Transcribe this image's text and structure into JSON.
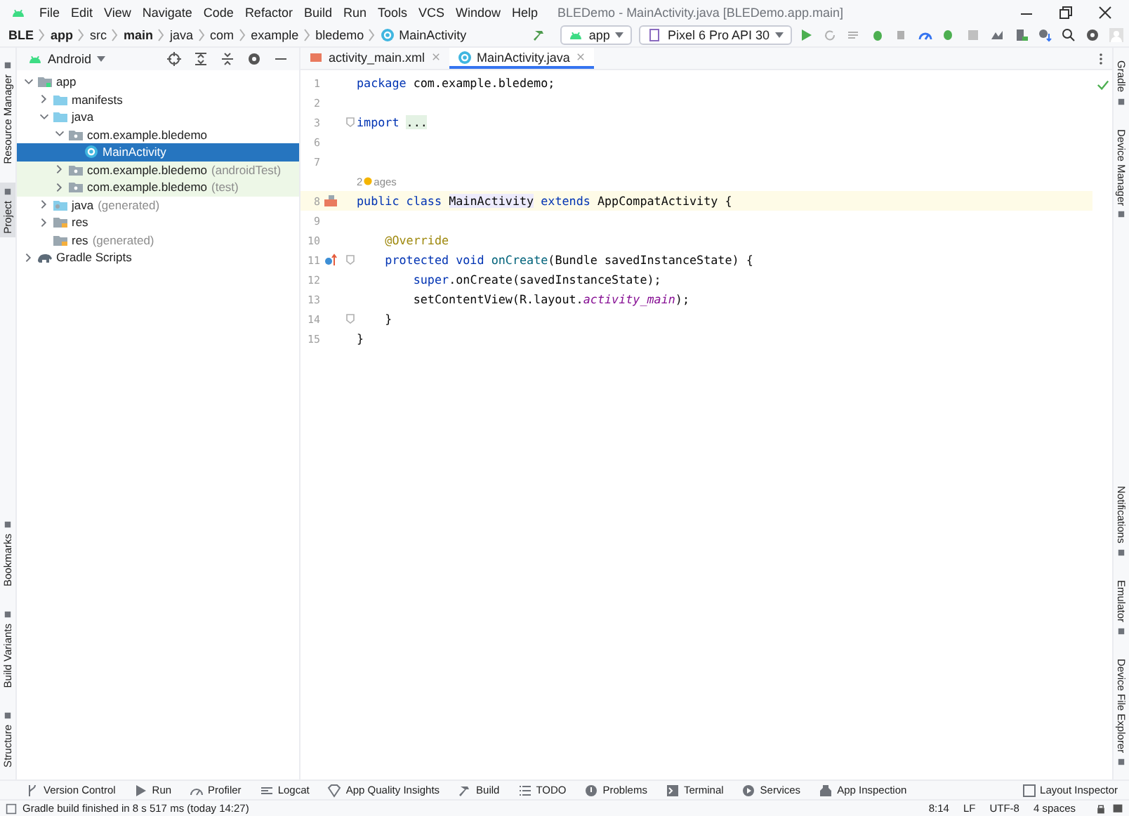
{
  "window": {
    "title": "BLEDemo - MainActivity.java [BLEDemo.app.main]"
  },
  "menu": [
    "File",
    "Edit",
    "View",
    "Navigate",
    "Code",
    "Refactor",
    "Build",
    "Run",
    "Tools",
    "VCS",
    "Window",
    "Help"
  ],
  "breadcrumbs": [
    {
      "label": "BLE",
      "bold": true,
      "kind": "text"
    },
    {
      "label": "app",
      "bold": true,
      "kind": "text"
    },
    {
      "label": "src",
      "bold": false,
      "kind": "text"
    },
    {
      "label": "main",
      "bold": true,
      "kind": "text"
    },
    {
      "label": "java",
      "bold": false,
      "kind": "text"
    },
    {
      "label": "com",
      "bold": false,
      "kind": "text"
    },
    {
      "label": "example",
      "bold": false,
      "kind": "text"
    },
    {
      "label": "bledemo",
      "bold": false,
      "kind": "text"
    },
    {
      "label": "MainActivity",
      "bold": false,
      "kind": "class"
    }
  ],
  "toolbar": {
    "configuration": "app",
    "device": "Pixel 6 Pro API 30"
  },
  "left_stripe": {
    "top": [
      {
        "label": "Resource Manager",
        "selected": false
      },
      {
        "label": "Project",
        "selected": true
      }
    ],
    "bottom": [
      {
        "label": "Bookmarks",
        "selected": false
      },
      {
        "label": "Build Variants",
        "selected": false
      },
      {
        "label": "Structure",
        "selected": false
      }
    ]
  },
  "right_stripe": {
    "top": [
      {
        "label": "Gradle"
      },
      {
        "label": "Device Manager"
      }
    ],
    "bottom": [
      {
        "label": "Notifications"
      },
      {
        "label": "Emulator"
      },
      {
        "label": "Device File Explorer"
      }
    ]
  },
  "project_panel": {
    "view": "Android",
    "tree": [
      {
        "label": "app",
        "kind": "module",
        "expanded": true,
        "selected": false,
        "test_source": false,
        "children": [
          {
            "label": "manifests",
            "kind": "folder",
            "expanded": false,
            "selected": false,
            "test_source": false
          },
          {
            "label": "java",
            "kind": "folder",
            "expanded": true,
            "selected": false,
            "test_source": false,
            "children": [
              {
                "label": "com.example.bledemo",
                "kind": "package",
                "expanded": true,
                "selected": false,
                "test_source": false,
                "children": [
                  {
                    "label": "MainActivity",
                    "kind": "class",
                    "selected": true,
                    "test_source": false
                  }
                ]
              },
              {
                "label": "com.example.bledemo",
                "suffix": "(androidTest)",
                "kind": "package",
                "expanded": false,
                "selected": false,
                "test_source": true
              },
              {
                "label": "com.example.bledemo",
                "suffix": "(test)",
                "kind": "package",
                "expanded": false,
                "selected": false,
                "test_source": true
              }
            ]
          },
          {
            "label": "java",
            "suffix": "(generated)",
            "kind": "generated",
            "expanded": false,
            "selected": false,
            "test_source": false
          },
          {
            "label": "res",
            "kind": "res",
            "expanded": false,
            "selected": false,
            "test_source": false
          },
          {
            "label": "res",
            "suffix": "(generated)",
            "kind": "res",
            "selected": false,
            "test_source": false
          }
        ]
      },
      {
        "label": "Gradle Scripts",
        "kind": "gradle",
        "expanded": false,
        "selected": false,
        "test_source": false
      }
    ]
  },
  "editor": {
    "tabs": [
      {
        "label": "activity_main.xml",
        "kind": "xml",
        "selected": false
      },
      {
        "label": "MainActivity.java",
        "kind": "class",
        "selected": true
      }
    ],
    "lines": [
      {
        "kind": "code",
        "number": "1",
        "current": false,
        "fold": false,
        "tokens": [
          {
            "text": "package",
            "kind": "keyword"
          },
          {
            "text": " com.example.bledemo;",
            "kind": "plain"
          }
        ]
      },
      {
        "kind": "code",
        "number": "2",
        "current": false,
        "fold": false
      },
      {
        "kind": "code",
        "number": "3",
        "current": false,
        "fold": true,
        "tokens": [
          {
            "text": "import ",
            "kind": "keyword"
          },
          {
            "text": "...",
            "kind": "folded"
          }
        ]
      },
      {
        "kind": "code",
        "number": "6",
        "current": false,
        "fold": false
      },
      {
        "kind": "code",
        "number": "7",
        "current": false,
        "fold": false
      },
      {
        "kind": "hint",
        "before": "2",
        "after": "ages"
      },
      {
        "kind": "implemented_code",
        "number": "8",
        "current": true,
        "fold": false,
        "tokens": [
          {
            "text": "public class ",
            "kind": "keyword"
          },
          {
            "text": "MainActivity",
            "kind": "highlighted"
          },
          {
            "text": " extends",
            "kind": "keyword"
          },
          {
            "text": " AppCompatActivity {",
            "kind": "plain"
          }
        ]
      },
      {
        "kind": "code",
        "number": "9",
        "current": false,
        "fold": false
      },
      {
        "kind": "code",
        "number": "10",
        "current": false,
        "fold": false,
        "tokens": [
          {
            "text": "    @Override",
            "kind": "annotation"
          }
        ]
      },
      {
        "kind": "overriding_code",
        "number": "11",
        "current": false,
        "fold": true,
        "tokens": [
          {
            "text": "    protected void ",
            "kind": "keyword"
          },
          {
            "text": "onCreate",
            "kind": "method"
          },
          {
            "text": "(Bundle savedInstanceState) {",
            "kind": "plain"
          }
        ]
      },
      {
        "kind": "code",
        "number": "12",
        "current": false,
        "fold": false,
        "tokens": [
          {
            "text": "        super",
            "kind": "keyword"
          },
          {
            "text": ".onCreate(savedInstanceState);",
            "kind": "plain"
          }
        ]
      },
      {
        "kind": "code",
        "number": "13",
        "current": false,
        "fold": false,
        "tokens": [
          {
            "text": "        setContentView(R.layout.",
            "kind": "plain"
          },
          {
            "text": "activity_main",
            "kind": "field"
          },
          {
            "text": ");",
            "kind": "plain"
          }
        ]
      },
      {
        "kind": "code",
        "number": "14",
        "current": false,
        "fold": true,
        "tokens": [
          {
            "text": "    }",
            "kind": "plain"
          }
        ]
      },
      {
        "kind": "code",
        "number": "15",
        "current": false,
        "fold": false,
        "tokens": [
          {
            "text": "}",
            "kind": "plain"
          }
        ]
      }
    ]
  },
  "tool_windows": [
    {
      "label": "Version Control",
      "kind": "vcs"
    },
    {
      "label": "Run",
      "kind": "run"
    },
    {
      "label": "Profiler",
      "kind": "profiler"
    },
    {
      "label": "Logcat",
      "kind": "logcat"
    },
    {
      "label": "App Quality Insights",
      "kind": "insights"
    },
    {
      "label": "Build",
      "kind": "build"
    },
    {
      "label": "TODO",
      "kind": "todo"
    },
    {
      "label": "Problems",
      "kind": "problems"
    },
    {
      "label": "Terminal",
      "kind": "terminal"
    },
    {
      "label": "Services",
      "kind": "services"
    },
    {
      "label": "App Inspection",
      "kind": "inspection"
    }
  ],
  "layout_inspector": "Layout Inspector",
  "status_bar": {
    "message": "Gradle build finished in 8 s 517 ms (today 14:27)",
    "items": [
      "8:14",
      "LF",
      "UTF-8",
      "4 spaces"
    ]
  }
}
